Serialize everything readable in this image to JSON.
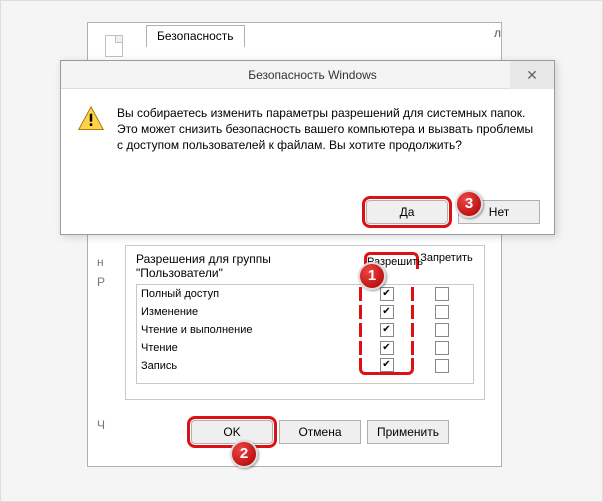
{
  "tab": {
    "label": "Безопасность"
  },
  "dialog": {
    "title": "Безопасность Windows",
    "message": "Вы собираетесь изменить параметры разрешений для системных папок. Это может снизить безопасность вашего компьютера и вызвать проблемы с доступом пользователей к файлам. Вы хотите продолжить?",
    "yes": "Да",
    "no": "Нет",
    "close": "✕"
  },
  "permissions": {
    "title_line1": "Разрешения для группы",
    "title_line2": "\"Пользователи\"",
    "allow": "Разрешить",
    "deny": "Запретить",
    "rows": [
      {
        "label": "Полный доступ",
        "allow": true,
        "deny": false
      },
      {
        "label": "Изменение",
        "allow": true,
        "deny": false
      },
      {
        "label": "Чтение и выполнение",
        "allow": true,
        "deny": false
      },
      {
        "label": "Чтение",
        "allow": true,
        "deny": false
      },
      {
        "label": "Запись",
        "allow": true,
        "deny": false
      }
    ]
  },
  "buttons": {
    "ok": "OK",
    "cancel": "Отмена",
    "apply": "Применить"
  },
  "faint": {
    "r": "Р",
    "h": "н",
    "ch": "Ч"
  },
  "badges": {
    "b1": "1",
    "b2": "2",
    "b3": "3"
  },
  "stray": {
    "l": "л"
  }
}
